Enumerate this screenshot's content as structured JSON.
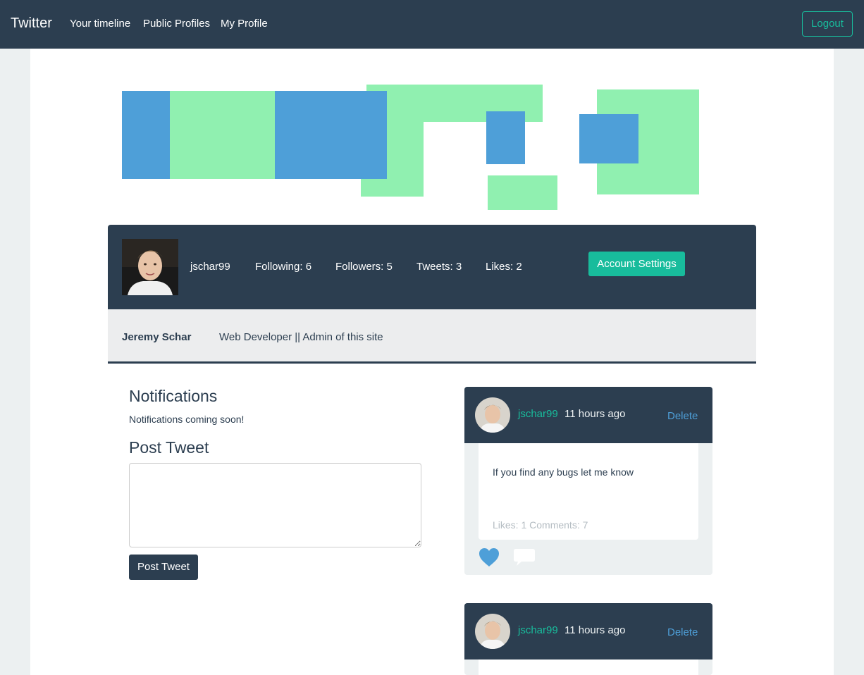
{
  "navbar": {
    "brand": "Twitter",
    "links": [
      "Your timeline",
      "Public Profiles",
      "My Profile"
    ],
    "logout": "Logout"
  },
  "profile": {
    "username": "jschar99",
    "following": "Following: 6",
    "followers": "Followers: 5",
    "tweets": "Tweets: 3",
    "likes": "Likes: 2",
    "account_settings": "Account Settings",
    "full_name": "Jeremy Schar",
    "bio": "Web Developer || Admin of this site"
  },
  "left": {
    "notifications_heading": "Notifications",
    "notifications_text": "Notifications coming soon!",
    "post_heading": "Post Tweet",
    "tweet_placeholder": "",
    "post_button": "Post Tweet"
  },
  "tweets": [
    {
      "user": "jschar99",
      "time": "11 hours ago",
      "delete": "Delete",
      "text": "If you find any bugs let me know",
      "meta": "Likes: 1 Comments: 7"
    },
    {
      "user": "jschar99",
      "time": "11 hours ago",
      "delete": "Delete"
    }
  ],
  "colors": {
    "navy": "#2c3e50",
    "teal": "#18bc9c",
    "blue": "#4e9fd8",
    "green": "#90f0b0",
    "light": "#ecf0f1"
  },
  "icons": [
    "heart-icon",
    "comment-icon"
  ]
}
